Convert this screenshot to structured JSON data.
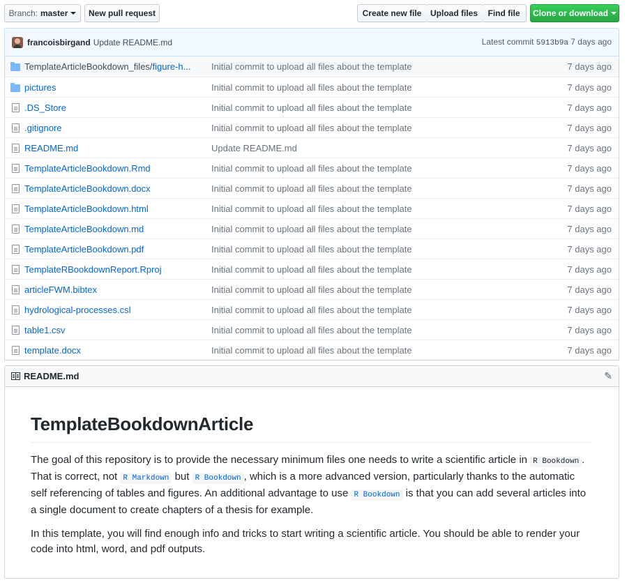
{
  "toolbar": {
    "branch_label": "Branch:",
    "branch_name": "master",
    "new_pr": "New pull request",
    "create_file": "Create new file",
    "upload_files": "Upload files",
    "find_file": "Find file",
    "clone_download": "Clone or download",
    "accent_green": "#28a745"
  },
  "commit": {
    "author": "francoisbirgand",
    "message": "Update README.md",
    "latest_label": "Latest commit",
    "sha": "5913b9a",
    "age": "7 days ago"
  },
  "files": [
    {
      "type": "folder",
      "dir": "TemplateArticleBookdown_files/",
      "name": "figure-h...",
      "message": "Initial commit to upload all files about the template",
      "age": "7 days ago"
    },
    {
      "type": "folder",
      "dir": "",
      "name": "pictures",
      "message": "Initial commit to upload all files about the template",
      "age": "7 days ago"
    },
    {
      "type": "file",
      "dir": "",
      "name": ".DS_Store",
      "message": "Initial commit to upload all files about the template",
      "age": "7 days ago"
    },
    {
      "type": "file",
      "dir": "",
      "name": ".gitignore",
      "message": "Initial commit to upload all files about the template",
      "age": "7 days ago"
    },
    {
      "type": "file",
      "dir": "",
      "name": "README.md",
      "message": "Update README.md",
      "age": "7 days ago"
    },
    {
      "type": "file",
      "dir": "",
      "name": "TemplateArticleBookdown.Rmd",
      "message": "Initial commit to upload all files about the template",
      "age": "7 days ago"
    },
    {
      "type": "file",
      "dir": "",
      "name": "TemplateArticleBookdown.docx",
      "message": "Initial commit to upload all files about the template",
      "age": "7 days ago"
    },
    {
      "type": "file",
      "dir": "",
      "name": "TemplateArticleBookdown.html",
      "message": "Initial commit to upload all files about the template",
      "age": "7 days ago"
    },
    {
      "type": "file",
      "dir": "",
      "name": "TemplateArticleBookdown.md",
      "message": "Initial commit to upload all files about the template",
      "age": "7 days ago"
    },
    {
      "type": "file",
      "dir": "",
      "name": "TemplateArticleBookdown.pdf",
      "message": "Initial commit to upload all files about the template",
      "age": "7 days ago"
    },
    {
      "type": "file",
      "dir": "",
      "name": "TemplateRBookdownReport.Rproj",
      "message": "Initial commit to upload all files about the template",
      "age": "7 days ago"
    },
    {
      "type": "file",
      "dir": "",
      "name": "articleFWM.bibtex",
      "message": "Initial commit to upload all files about the template",
      "age": "7 days ago"
    },
    {
      "type": "file",
      "dir": "",
      "name": "hydrological-processes.csl",
      "message": "Initial commit to upload all files about the template",
      "age": "7 days ago"
    },
    {
      "type": "file",
      "dir": "",
      "name": "table1.csv",
      "message": "Initial commit to upload all files about the template",
      "age": "7 days ago"
    },
    {
      "type": "file",
      "dir": "",
      "name": "template.docx",
      "message": "Initial commit to upload all files about the template",
      "age": "7 days ago"
    }
  ],
  "readme": {
    "filename": "README.md",
    "heading": "TemplateBookdownArticle",
    "p1": {
      "t1": "The goal of this repository is to provide the necessary minimum files one needs to write a scientific article in ",
      "c1": "R Bookdown",
      "t2": ". That is correct, not ",
      "c2": "R Markdown",
      "t3": " but ",
      "c3": "R Bookdown",
      "t4": ", which is a more advanced version, particularly thanks to the automatic self referencing of tables and figures. An additional advantage to use ",
      "c4": "R Bookdown",
      "t5": " is that you can add several articles into a single document to create chapters of a thesis for example."
    },
    "p2": "In this template, you will find enough info and tricks to start writing a scientific article. You should be able to render your code into html, word, and pdf outputs."
  }
}
